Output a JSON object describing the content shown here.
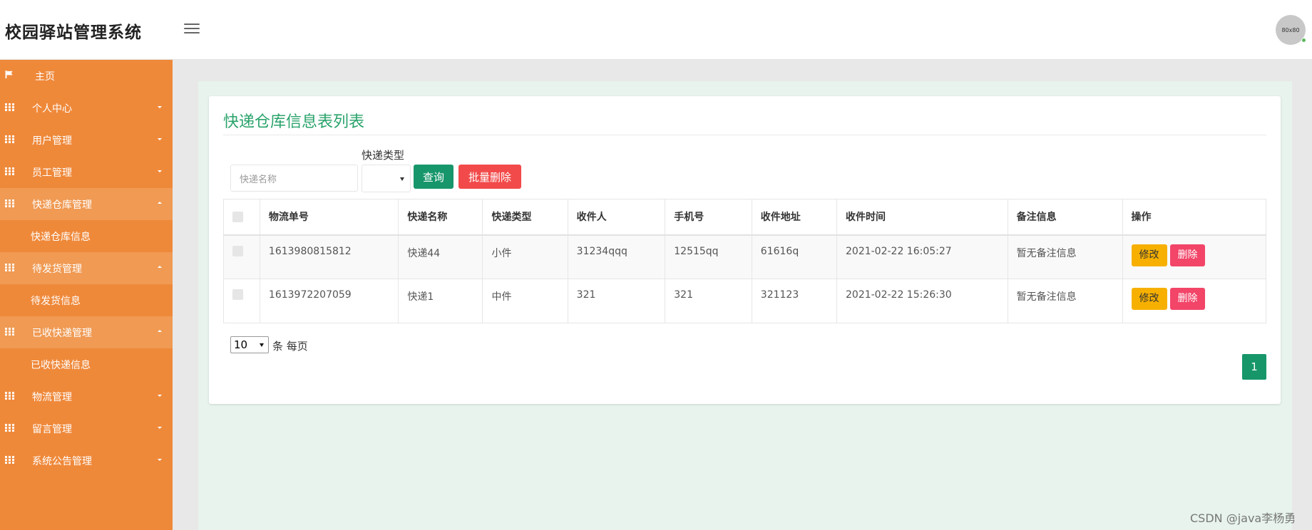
{
  "header": {
    "title": "校园驿站管理系统",
    "avatar_text": "80x80"
  },
  "sidebar": {
    "items": [
      {
        "label": "主页",
        "icon": "flag-icon",
        "state": "none"
      },
      {
        "label": "个人中心",
        "icon": "grid-icon",
        "state": "collapsed"
      },
      {
        "label": "用户管理",
        "icon": "grid-icon",
        "state": "collapsed"
      },
      {
        "label": "员工管理",
        "icon": "grid-icon",
        "state": "collapsed"
      },
      {
        "label": "快递仓库管理",
        "icon": "grid-icon",
        "state": "expanded"
      },
      {
        "label": "快递仓库信息",
        "sub": true
      },
      {
        "label": "待发货管理",
        "icon": "grid-icon",
        "state": "expanded"
      },
      {
        "label": "待发货信息",
        "sub": true
      },
      {
        "label": "已收快递管理",
        "icon": "grid-icon",
        "state": "expanded"
      },
      {
        "label": "已收快递信息",
        "sub": true
      },
      {
        "label": "物流管理",
        "icon": "grid-icon",
        "state": "collapsed"
      },
      {
        "label": "留言管理",
        "icon": "grid-icon",
        "state": "collapsed"
      },
      {
        "label": "系统公告管理",
        "icon": "grid-icon",
        "state": "collapsed"
      }
    ]
  },
  "main": {
    "title": "快递仓库信息表列表",
    "search": {
      "placeholder": "快递名称",
      "type_label": "快递类型",
      "type_value": ""
    },
    "buttons": {
      "query": "查询",
      "batch_delete": "批量删除"
    },
    "table": {
      "headers": [
        "物流单号",
        "快递名称",
        "快递类型",
        "收件人",
        "手机号",
        "收件地址",
        "收件时间",
        "备注信息",
        "操作"
      ],
      "rows": [
        [
          "1613980815812",
          "快递44",
          "小件",
          "31234qqq",
          "12515qq",
          "61616q",
          "2021-02-22 16:05:27",
          "暂无备注信息"
        ],
        [
          "1613972207059",
          "快递1",
          "中件",
          "321",
          "321",
          "321123",
          "2021-02-22 15:26:30",
          "暂无备注信息"
        ]
      ],
      "row_actions": {
        "edit": "修改",
        "delete": "删除"
      }
    },
    "pagination": {
      "page_size": "10",
      "per_page_label": "条 每页",
      "current_page": "1"
    }
  },
  "watermark": "CSDN @java李杨勇",
  "colors": {
    "sidebar": "#ef893a",
    "accent_green": "#18966b",
    "title_green": "#2aa36b",
    "danger": "#f24a4a",
    "warning": "#f7b000"
  }
}
